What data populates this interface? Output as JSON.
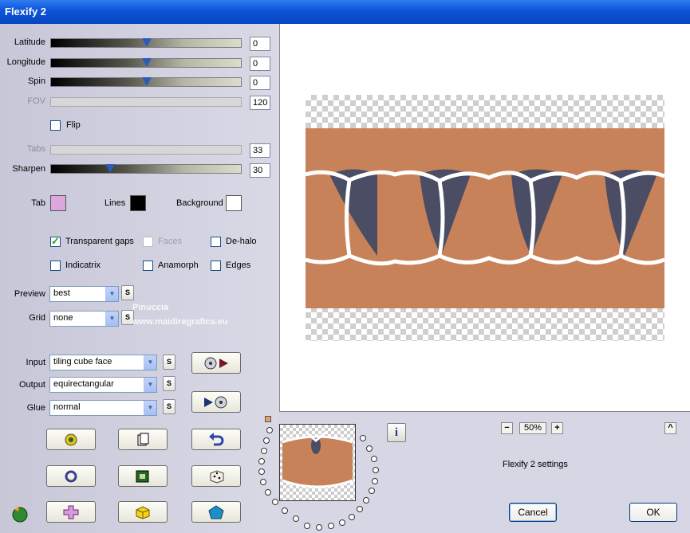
{
  "window": {
    "title": "Flexify 2"
  },
  "sliders": {
    "latitude": {
      "label": "Latitude",
      "value": "0",
      "level": 0.5
    },
    "longitude": {
      "label": "Longitude",
      "value": "0",
      "level": 0.5
    },
    "spin": {
      "label": "Spin",
      "value": "0",
      "level": 0.5
    },
    "fov": {
      "label": "FOV",
      "value": "120"
    },
    "tabs": {
      "label": "Tabs",
      "value": "33"
    },
    "sharpen": {
      "label": "Sharpen",
      "value": "30",
      "level": 0.3
    }
  },
  "flip": {
    "label": "Flip",
    "checked": false
  },
  "colors": {
    "tab": {
      "label": "Tab",
      "hex": "#dca8dc"
    },
    "lines": {
      "label": "Lines",
      "hex": "#000000"
    },
    "background": {
      "label": "Background",
      "hex": "#ffffff"
    }
  },
  "options": {
    "transparent_gaps": {
      "label": "Transparent gaps",
      "checked": true
    },
    "faces": {
      "label": "Faces",
      "checked": false,
      "disabled": true
    },
    "de_halo": {
      "label": "De-halo",
      "checked": false
    },
    "indicatrix": {
      "label": "Indicatrix",
      "checked": false
    },
    "anamorph": {
      "label": "Anamorph",
      "checked": false
    },
    "edges": {
      "label": "Edges",
      "checked": false
    }
  },
  "dropdowns": {
    "preview": {
      "label": "Preview",
      "value": "best"
    },
    "grid": {
      "label": "Grid",
      "value": "none"
    },
    "input": {
      "label": "Input",
      "value": "tiling cube face"
    },
    "output": {
      "label": "Output",
      "value": "equirectangular"
    },
    "glue": {
      "label": "Glue",
      "value": "normal"
    }
  },
  "small_button_label": "S",
  "watermark": {
    "line1": "Pinuccia",
    "line2": "www.maidiregrafica.eu"
  },
  "zoom": {
    "value": "50%",
    "minus": "−",
    "plus": "+"
  },
  "settings_name": "Flexify 2 settings",
  "buttons": {
    "cancel": "Cancel",
    "ok": "OK",
    "collapse": "^",
    "info": "i"
  },
  "icons": {
    "tool_row1": [
      "lens-gear-icon",
      "copy-pages-icon",
      "undo-arrow-icon"
    ],
    "tool_row2": [
      "ring-icon",
      "square-frame-icon",
      "dice-icon"
    ],
    "tool_row3": [
      "cross-shape-icon",
      "cube-icon",
      "pentagon-icon"
    ],
    "colors": {
      "band": "#c8825a",
      "dark": "#4a4d63",
      "line": "#ffffff",
      "accent": "#0a53d8"
    }
  }
}
